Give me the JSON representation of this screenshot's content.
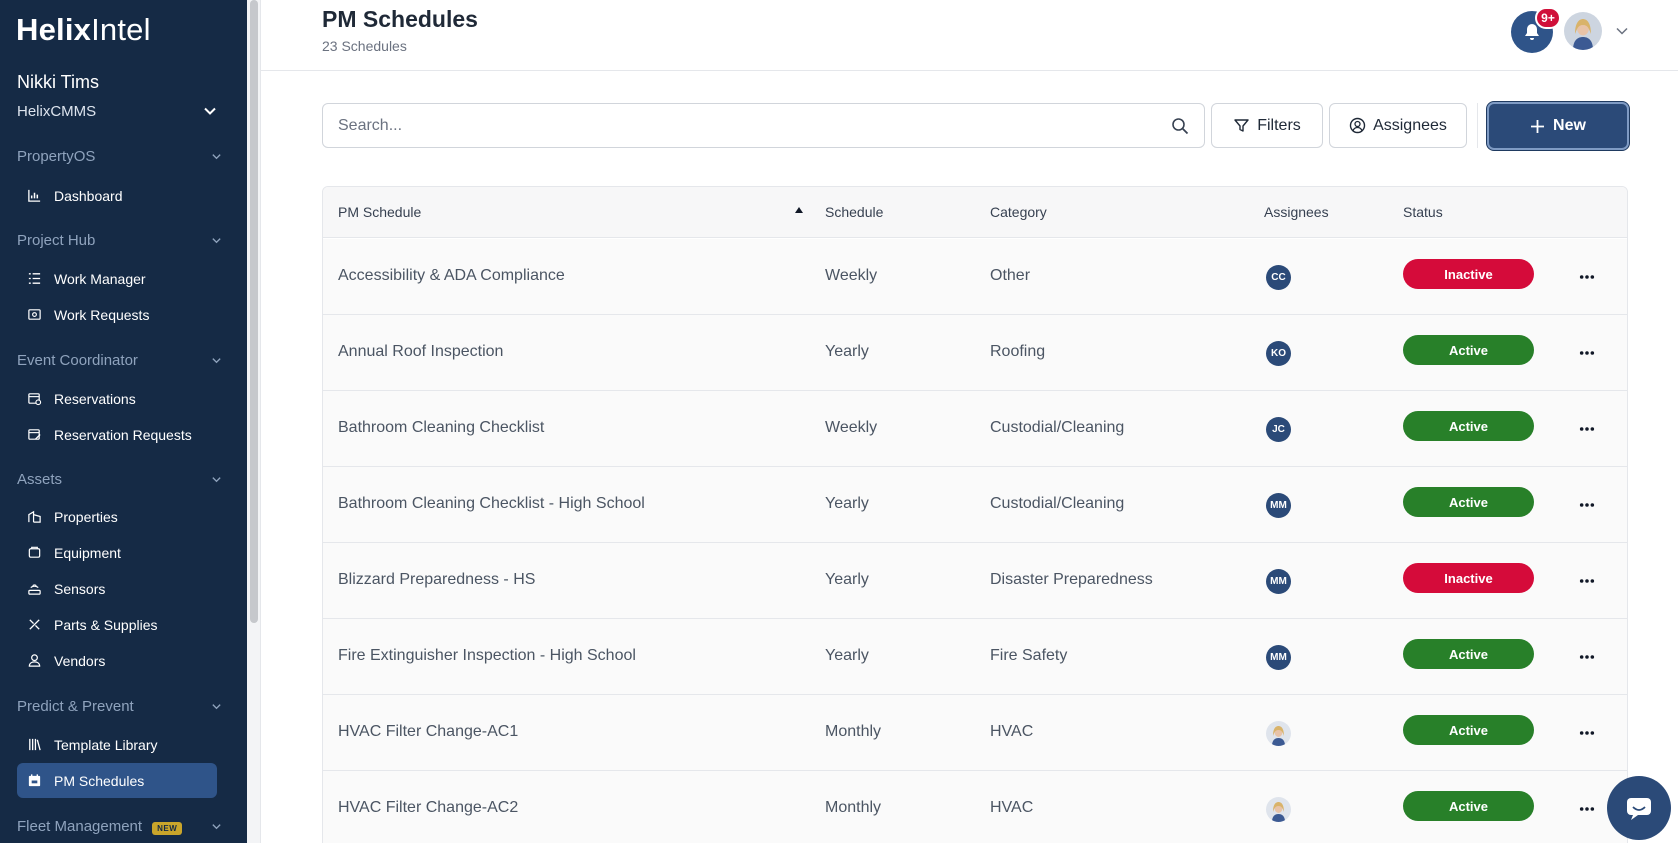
{
  "app": {
    "logo_bold": "Helix",
    "logo_light": "Intel"
  },
  "user": {
    "name": "Nikki Tims",
    "org": "HelixCMMS"
  },
  "sidebar": {
    "sections": [
      {
        "label": "PropertyOS"
      },
      {
        "label": "Project Hub"
      },
      {
        "label": "Event Coordinator"
      },
      {
        "label": "Assets"
      },
      {
        "label": "Predict & Prevent"
      },
      {
        "label": "Fleet Management",
        "badge": "NEW"
      }
    ],
    "items": [
      {
        "label": "Dashboard",
        "icon": "bar-chart-icon"
      },
      {
        "label": "Work Manager",
        "icon": "list-icon"
      },
      {
        "label": "Work Requests",
        "icon": "inbox-icon"
      },
      {
        "label": "Reservations",
        "icon": "calendar-clock-icon"
      },
      {
        "label": "Reservation Requests",
        "icon": "calendar-edit-icon"
      },
      {
        "label": "Properties",
        "icon": "building-icon"
      },
      {
        "label": "Equipment",
        "icon": "equipment-icon"
      },
      {
        "label": "Sensors",
        "icon": "sensor-icon"
      },
      {
        "label": "Parts & Supplies",
        "icon": "tools-icon"
      },
      {
        "label": "Vendors",
        "icon": "person-icon"
      },
      {
        "label": "Template Library",
        "icon": "library-icon"
      },
      {
        "label": "PM Schedules",
        "icon": "calendar-icon",
        "active": true
      }
    ]
  },
  "header": {
    "title": "PM Schedules",
    "subtitle": "23 Schedules",
    "notification_count": "9+"
  },
  "toolbar": {
    "search_placeholder": "Search...",
    "filters_label": "Filters",
    "assignees_label": "Assignees",
    "new_label": "New"
  },
  "table": {
    "columns": [
      "PM Schedule",
      "Schedule",
      "Category",
      "Assignees",
      "Status"
    ],
    "rows": [
      {
        "name": "Accessibility & ADA Compliance",
        "schedule": "Weekly",
        "category": "Other",
        "assignee": "CC",
        "status": "Inactive"
      },
      {
        "name": "Annual Roof Inspection",
        "schedule": "Yearly",
        "category": "Roofing",
        "assignee": "KO",
        "status": "Active"
      },
      {
        "name": "Bathroom Cleaning Checklist",
        "schedule": "Weekly",
        "category": "Custodial/Cleaning",
        "assignee": "JC",
        "status": "Active"
      },
      {
        "name": "Bathroom Cleaning Checklist - High School",
        "schedule": "Yearly",
        "category": "Custodial/Cleaning",
        "assignee": "MM",
        "status": "Active"
      },
      {
        "name": "Blizzard Preparedness - HS",
        "schedule": "Yearly",
        "category": "Disaster Preparedness",
        "assignee": "MM",
        "status": "Inactive"
      },
      {
        "name": "Fire Extinguisher Inspection - High School",
        "schedule": "Yearly",
        "category": "Fire Safety",
        "assignee": "MM",
        "status": "Active"
      },
      {
        "name": "HVAC Filter Change-AC1",
        "schedule": "Monthly",
        "category": "HVAC",
        "assignee": "photo",
        "status": "Active"
      },
      {
        "name": "HVAC Filter Change-AC2",
        "schedule": "Monthly",
        "category": "HVAC",
        "assignee": "photo",
        "status": "Active"
      }
    ]
  },
  "colors": {
    "sidebar_bg": "#152a45",
    "active_nav": "#2f5489",
    "primary": "#2b4a78",
    "status_active": "#288029",
    "status_inactive": "#d50b3a"
  }
}
